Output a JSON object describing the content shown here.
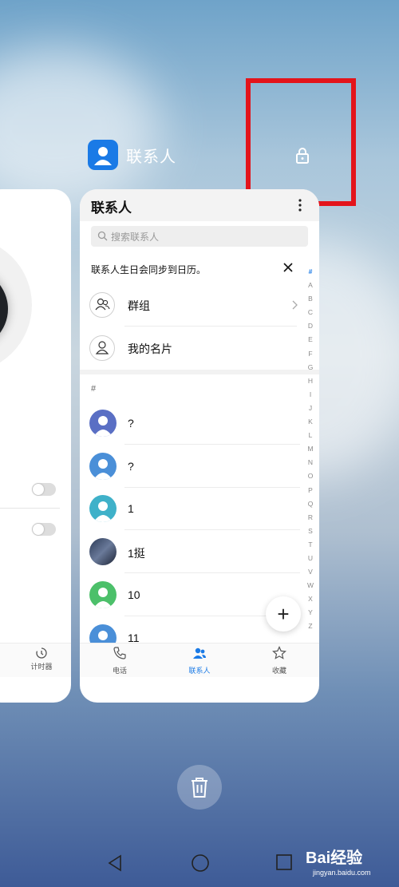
{
  "app_header": {
    "title": "联系人"
  },
  "left_card": {
    "tab_label": "计时器"
  },
  "card": {
    "title": "联系人",
    "search_placeholder": "搜索联系人",
    "notice": "联系人生日会同步到日历。",
    "rows": [
      {
        "label": "群组",
        "icon": "group-icon"
      },
      {
        "label": "我的名片",
        "icon": "person-icon"
      }
    ],
    "section_header": "#",
    "contacts": [
      {
        "name": "?",
        "avatar_color": "#5a6fc4"
      },
      {
        "name": "?",
        "avatar_color": "#4a8fd8"
      },
      {
        "name": "1",
        "avatar_color": "#3fb1c9"
      },
      {
        "name": "1挺",
        "avatar_color": "#2b3a55"
      },
      {
        "name": "10",
        "avatar_color": "#4cc06a"
      },
      {
        "name": "11",
        "avatar_color": "#4a8fd8"
      }
    ],
    "index_letters": [
      "#",
      "A",
      "B",
      "C",
      "D",
      "E",
      "F",
      "G",
      "H",
      "I",
      "J",
      "K",
      "L",
      "M",
      "N",
      "O",
      "P",
      "Q",
      "R",
      "S",
      "T",
      "U",
      "V",
      "W",
      "X",
      "Y",
      "Z"
    ],
    "tabs": [
      {
        "label": "电话",
        "icon": "phone-icon"
      },
      {
        "label": "联系人",
        "icon": "contacts-icon",
        "active": true
      },
      {
        "label": "收藏",
        "icon": "star-icon"
      }
    ],
    "fab_label": "+"
  },
  "watermark": {
    "main": "Bai经验",
    "sub": "jingyan.baidu.com"
  },
  "colors": {
    "accent": "#1a7ae6",
    "highlight_box": "#e3141b"
  }
}
